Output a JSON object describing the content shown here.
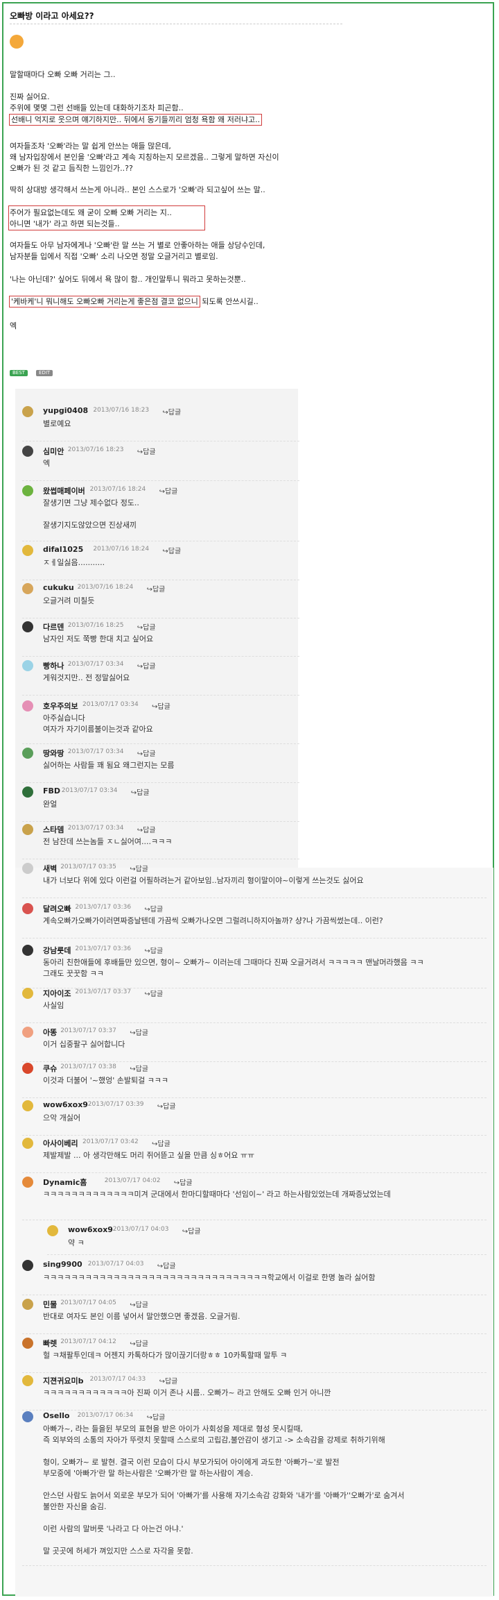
{
  "post": {
    "title": "오빠방 이라고 아세요??",
    "lines": [
      "말할때마다 오빠 오빠 거리는 그..",
      "진짜 싫어요.",
      "주위에 몇몇 그런 선배들 있는데 대화하기조차 피곤함..",
      "선배니 억지로 웃으며 얘기하지만.. 뒤에서 동기들끼리 엄청 욕함 왜 저러냐고..",
      "여자들조차 '오빠'라는 말 쉽게 안쓰는 애들 많은데,",
      "왜 남자입장에서 본인을 '오빠'라고 계속 지칭하는지 모르겠음.. 그렇게 말하면 자신이",
      "오빠가 된 것 같고 듬직한 느낌인가..??",
      "딱히 상대방 생각해서 쓰는게 아니라.. 본인 스스로가 '오빠'라 되고싶어 쓰는 말..",
      "주어가 필요없는데도 왜 굳이 오빠 오빠 거리는 지..",
      "아니면 '내가' 라고 하면 되는것들..",
      "여자들도 아무 남자에게나 '오빠'란 말 쓰는 거 별로 안좋아하는 애들 상당수인데,",
      "남자분들 입에서 직접 '오빠' 소리 나오면 정말 오글거리고 별로임.",
      "'나는 아닌데?' 싶어도 뒤에서 욕 많이 함.. 개인말투니 뭐라고 못하는것뿐..",
      "'케바케'니 뭐니해도 오빠오빠 거리는게 좋은점 결코 없으니",
      "되도록 안쓰시길..",
      "엑"
    ],
    "tags": [
      "BEST",
      "EDIT"
    ]
  },
  "comments": [
    {
      "nick": "yupgi0408",
      "date": "2013/07/16 18:23",
      "reply": "답글",
      "body": [
        "별로예요"
      ],
      "color": "#c9a24b"
    },
    {
      "nick": "심미안",
      "date": "2013/07/16 18:23",
      "reply": "답글",
      "body": [
        "엑"
      ],
      "color": "#444444"
    },
    {
      "nick": "왔썹매페이버",
      "date": "2013/07/16 18:24",
      "reply": "답글",
      "body": [
        "잘생기면 그냥 제수없다 정도..",
        "",
        "잘생기지도않았으면 진상새끼"
      ],
      "color": "#6cb33f"
    },
    {
      "nick": "difal1025",
      "date": "2013/07/16 18:24",
      "reply": "답글",
      "body": [
        "ㅈㅔ일싫음..........."
      ],
      "color": "#e2b83c"
    },
    {
      "nick": "cukuku",
      "date": "2013/07/16 18:24",
      "reply": "답글",
      "body": [
        "오글거려 미칠듯"
      ],
      "color": "#d7a65b"
    },
    {
      "nick": "다르덴",
      "date": "2013/07/16 18:25",
      "reply": "답글",
      "body": [
        "남자인 저도 쭉빵 한대 치고 싶어요"
      ],
      "color": "#333333"
    },
    {
      "nick": "빵하나",
      "date": "2013/07/17 03:34",
      "reply": "답글",
      "body": [
        "게워것지만.. 전 정말싫어요"
      ],
      "color": "#9bd3e6"
    },
    {
      "nick": "호우주의보",
      "date": "2013/07/17 03:34",
      "reply": "답글",
      "body": [
        "아주싫습니다",
        "여자가 자기이름불이는것과 같아요"
      ],
      "color": "#e58fb5"
    },
    {
      "nick": "땅와땅",
      "date": "2013/07/17 03:34",
      "reply": "답글",
      "body": [
        "싫어하는 사람들 꽤 됨요 왜그런지는 모름"
      ],
      "color": "#5a9e5a"
    },
    {
      "nick": "FBD",
      "date": "2013/07/17 03:34",
      "reply": "답글",
      "body": [
        "완얼"
      ],
      "color": "#2f6f3a"
    },
    {
      "nick": "스타뎀",
      "date": "2013/07/17 03:34",
      "reply": "답글",
      "body": [
        "전 남잔데 쓰는놈들 ㅈㄴ싫어여....ㅋㅋㅋ"
      ],
      "color": "#c9a24b"
    },
    {
      "nick": "새벽",
      "date": "2013/07/17 03:35",
      "reply": "답글",
      "body": [
        "내가 너보다 위에 있다 이런걸 어필하려는거 같아보임..남자끼리 형이말이야~이렇게 쓰는것도 싫어요"
      ],
      "color": "#cccccc"
    },
    {
      "nick": "달려오빠",
      "date": "2013/07/17 03:36",
      "reply": "답글",
      "body": [
        "계속오빠가오빠가이러면짜증날텐데 가끔씩 오빠가나오면 그럴려니하지아놀까? 샹?나 가끔씩썼는데.. 이런?"
      ],
      "color": "#d9534f"
    },
    {
      "nick": "강남룻데",
      "date": "2013/07/17 03:36",
      "reply": "답글",
      "body": [
        "동아리 친한애들에 후배들만 있으면, 형이~ 오빠가~ 이러는데 그때마다 진짜 오글거려서 ㅋㅋㅋㅋㅋ 맨날머라했음 ㅋㅋ",
        "그래도 꿋꿋함 ㅋㅋ"
      ],
      "color": "#333333"
    },
    {
      "nick": "지아이조",
      "date": "2013/07/17 03:37",
      "reply": "답글",
      "body": [
        "사실임"
      ],
      "color": "#e2b83c"
    },
    {
      "nick": "아똥",
      "date": "2013/07/17 03:37",
      "reply": "답글",
      "body": [
        "이거 십중팔구 싫어합니다"
      ],
      "color": "#f0a080"
    },
    {
      "nick": "쿠슈",
      "date": "2013/07/17 03:38",
      "reply": "답글",
      "body": [
        "이것과 더불어 '~했엉' 손발퇴걸 ㅋㅋㅋ"
      ],
      "color": "#d9472b"
    },
    {
      "nick": "wow6xox9",
      "date": "2013/07/17 03:39",
      "reply": "답글",
      "body": [
        "으악 개싫어"
      ],
      "color": "#e2b83c"
    },
    {
      "nick": "아사이베리",
      "date": "2013/07/17 03:42",
      "reply": "답글",
      "body": [
        "제발제발 ... 아 생각만해도 머리 쥐어뜯고 싶을 만큼 싱ㅎ어요 ㅠㅠ"
      ],
      "color": "#e2b83c"
    },
    {
      "nick": "Dynamic흠",
      "date": "2013/07/17 04:02",
      "reply": "답글",
      "body": [
        "ㅋㅋㅋㅋㅋㅋㅋㅋㅋㅋㅋㅋㅋ미겨 군대에서 한마디할때마다 '선임이~' 라고 하는사람있었는데 개짜증났었는데"
      ],
      "color": "#e58a3a"
    },
    {
      "nick": "wow6xox9",
      "date": "2013/07/17 04:03",
      "reply": "답글",
      "body": [
        "약 ㅋ"
      ],
      "color": "#e2b83c",
      "nested": true
    },
    {
      "nick": "sing9900",
      "date": "2013/07/17 04:03",
      "reply": "답글",
      "body": [
        "ㅋㅋㅋㅋㅋㅋㅋㅋㅋㅋㅋㅋㅋㅋㅋㅋㅋㅋㅋㅋㅋㅋㅋㅋㅋㅋㅋㅋㅋㅋㅋㅋ학교에서 이걸로 한명 놀라 싫어함"
      ],
      "color": "#333333"
    },
    {
      "nick": "민물",
      "date": "2013/07/17 04:05",
      "reply": "답글",
      "body": [
        "반대로 여자도 본인 이름 넣어서 말안했으면 좋겠음. 오글거림."
      ],
      "color": "#c9a24b"
    },
    {
      "nick": "빠렛",
      "date": "2013/07/17 04:12",
      "reply": "답글",
      "body": [
        "헐 ㅋ채팔투인데ㅋ 어젠지 카톡하다가 많이끊기더랑ㅎㅎ 10카톡할때 말투 ㅋ"
      ],
      "color": "#c9732b"
    },
    {
      "nick": "지젼귀요미b",
      "date": "2013/07/17 04:33",
      "reply": "답글",
      "body": [
        "ㅋㅋㅋㅋㅋㅋㅋㅋㅋㅋㅋㅋ아 진짜 이거 존나 시름.. 오빠가~ 라고 안해도 오빠 인거 아니깐"
      ],
      "color": "#e2b83c"
    },
    {
      "nick": "Osello",
      "date": "2013/07/17 06:34",
      "reply": "답글",
      "body": [
        "아빠가~, 라는 들을뒨 부모의 표현을 받은 아이가 사회성을 제대로 형성 못시킬때,",
        "즉 외부와의 소통의 자아가 뚜렷치 못할때 스스로의 고립감,불안감이 생기고 -> 소속감을 강제로 취하기위해",
        "",
        "형이, 오빠가~ 로 발현. 결국 이런 모습이 다시 부모가되어 아이에게 과도한 '아빠가~'로 발전",
        "부모중에 '아빠가'란 말 하는사람은 '오빠가'란 말 하는사람이 계승.",
        "",
        "안스던 사람도 늙어서 외로운 부모가 되어 '아빠가'를 사용해 자기소속감 강화와 '내가'를 '아빠가''오빠가'로 숨겨서",
        "불안한 자신을 숨김.",
        "",
        "이런 사람의 말버릇 '나라고 다 아는건 아냐.'",
        "",
        "말 곳곳에 허세가 껴있지만 스스로 자각을 못함."
      ],
      "color": "#5a7fbf"
    }
  ]
}
